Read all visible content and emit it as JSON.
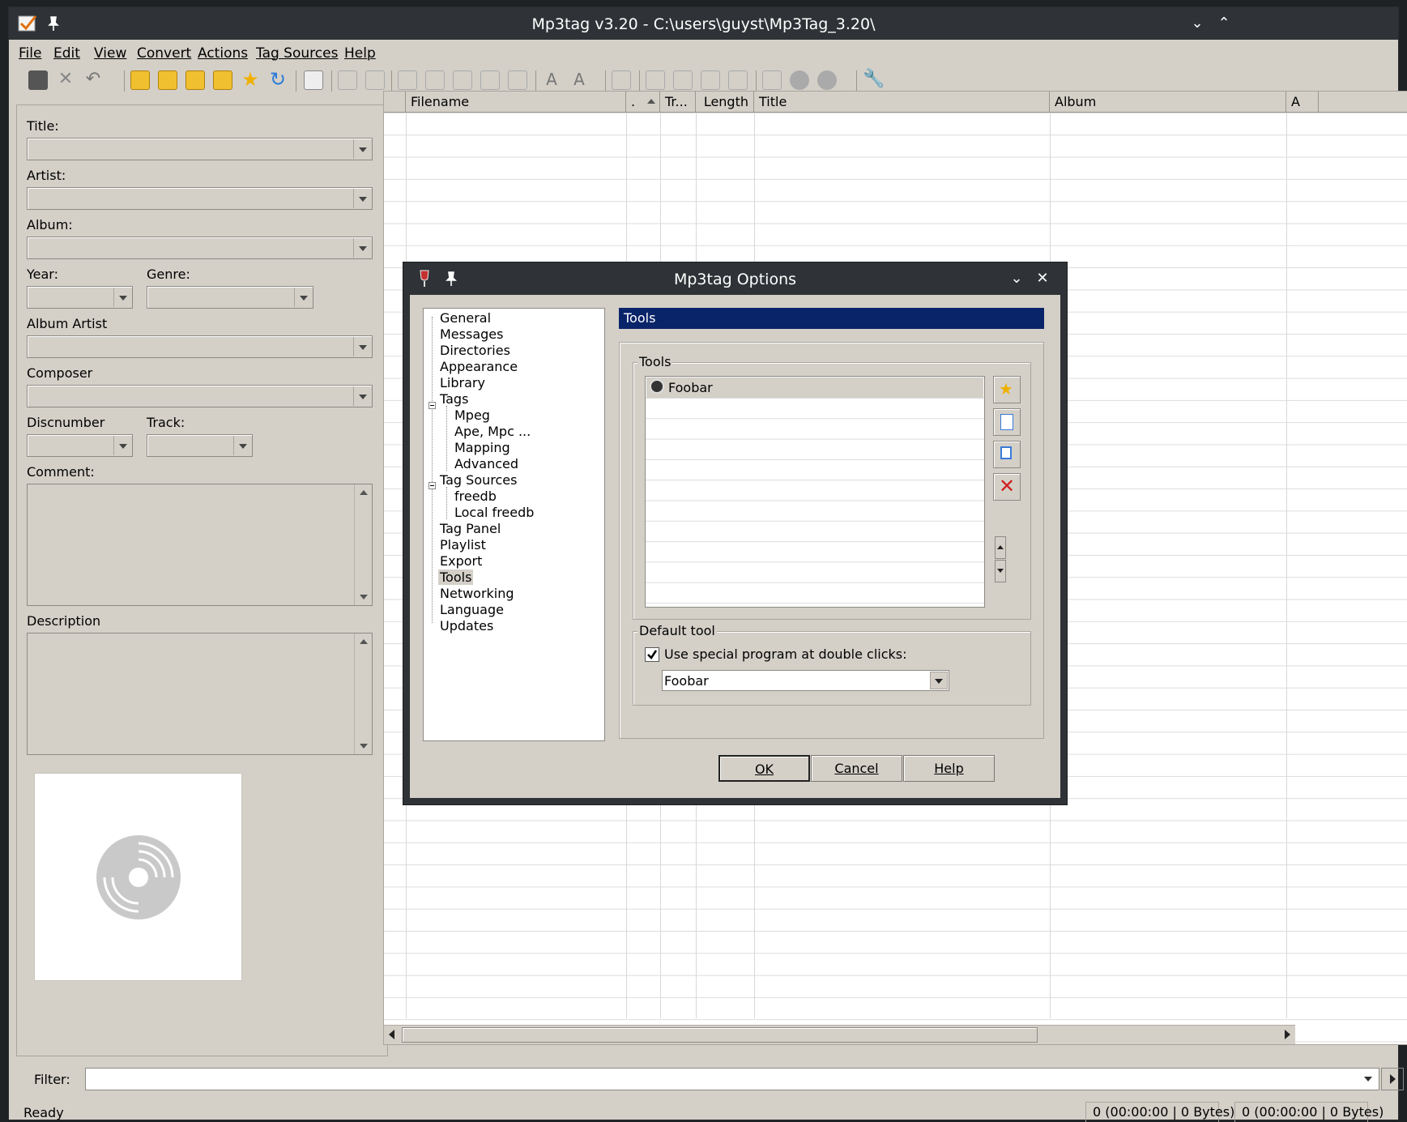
{
  "main_window": {
    "title": "Mp3tag v3.20 - C:\\users\\guyst\\Mp3Tag_3.20\\",
    "menu": [
      "File",
      "Edit",
      "View",
      "Convert",
      "Actions",
      "Tag Sources",
      "Help"
    ]
  },
  "tag_panel": {
    "title_label": "Title:",
    "artist_label": "Artist:",
    "album_label": "Album:",
    "year_label": "Year:",
    "genre_label": "Genre:",
    "album_artist_label": "Album Artist",
    "composer_label": "Composer",
    "discnumber_label": "Discnumber",
    "track_label": "Track:",
    "comment_label": "Comment:",
    "description_label": "Description"
  },
  "file_list": {
    "columns": [
      "Filename",
      ".",
      "Tr...",
      "Length",
      "Title",
      "Album",
      "A"
    ]
  },
  "filter": {
    "label": "Filter:"
  },
  "status": {
    "ready": "Ready",
    "cell1": "0 (00:00:00 | 0 Bytes)",
    "cell2": "0 (00:00:00 | 0 Bytes)"
  },
  "dialog": {
    "title": "Mp3tag Options",
    "tree": [
      "General",
      "Messages",
      "Directories",
      "Appearance",
      "Library",
      "Tags",
      "Mpeg",
      "Ape, Mpc ...",
      "Mapping",
      "Advanced",
      "Tag Sources",
      "freedb",
      "Local freedb",
      "Tag Panel",
      "Playlist",
      "Export",
      "Tools",
      "Networking",
      "Language",
      "Updates"
    ],
    "selected": "Tools",
    "header": "Tools",
    "tools_group": "Tools",
    "tools_items": [
      "Foobar"
    ],
    "default_group": "Default tool",
    "checkbox_label": "Use special program at double clicks:",
    "checkbox_checked": true,
    "default_value": "Foobar",
    "ok": "OK",
    "cancel": "Cancel",
    "help": "Help"
  },
  "icons": {
    "accent": "#0a246a",
    "titlebar": "#2f3337"
  }
}
